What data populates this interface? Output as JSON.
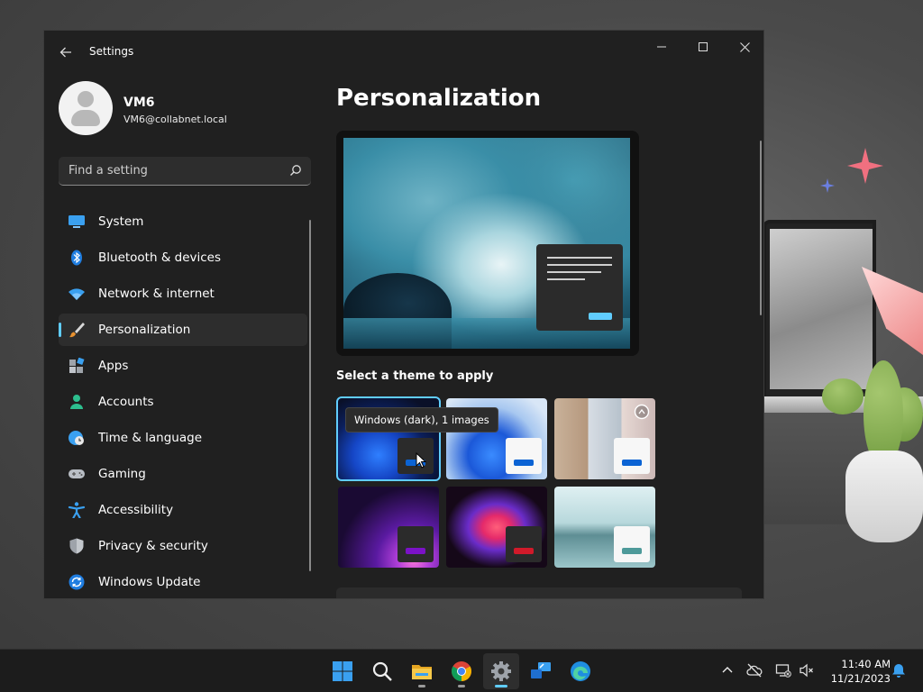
{
  "window": {
    "title": "Settings",
    "minimize_glyph": "—",
    "maximize_glyph": "☐",
    "close_glyph": "✕"
  },
  "profile": {
    "name": "VM6",
    "email": "VM6@collabnet.local"
  },
  "search": {
    "placeholder": "Find a setting"
  },
  "sidebar": {
    "items": [
      {
        "label": "System",
        "icon": "system-icon"
      },
      {
        "label": "Bluetooth & devices",
        "icon": "bluetooth-icon"
      },
      {
        "label": "Network & internet",
        "icon": "wifi-icon"
      },
      {
        "label": "Personalization",
        "icon": "brush-icon",
        "active": true
      },
      {
        "label": "Apps",
        "icon": "apps-icon"
      },
      {
        "label": "Accounts",
        "icon": "person-icon"
      },
      {
        "label": "Time & language",
        "icon": "globe-clock-icon"
      },
      {
        "label": "Gaming",
        "icon": "gamepad-icon"
      },
      {
        "label": "Accessibility",
        "icon": "accessibility-icon"
      },
      {
        "label": "Privacy & security",
        "icon": "shield-icon"
      },
      {
        "label": "Windows Update",
        "icon": "update-icon"
      }
    ]
  },
  "main": {
    "title": "Personalization",
    "theme_heading": "Select a theme to apply",
    "tooltip": "Windows (dark), 1 images",
    "themes": [
      {
        "name": "windows-dark",
        "selected": true,
        "accent": "#0b63d4"
      },
      {
        "name": "windows-light",
        "selected": false,
        "accent": "#0b63d4"
      },
      {
        "name": "spotlight",
        "selected": false,
        "accent": "#0b63d4"
      },
      {
        "name": "glow",
        "selected": false,
        "accent": "#7b12c7"
      },
      {
        "name": "captured-motion",
        "selected": false,
        "accent": "#d11a2a"
      },
      {
        "name": "flow",
        "selected": false,
        "accent": "#4e9a9a"
      }
    ]
  },
  "taskbar": {
    "apps": [
      "start-icon",
      "search-icon",
      "file-explorer-icon",
      "chrome-icon",
      "settings-icon",
      "remote-desktop-icon",
      "edge-icon"
    ],
    "time": "11:40 AM",
    "date": "11/21/2023"
  },
  "colors": {
    "accent": "#60cdff",
    "window_bg": "#202020"
  }
}
